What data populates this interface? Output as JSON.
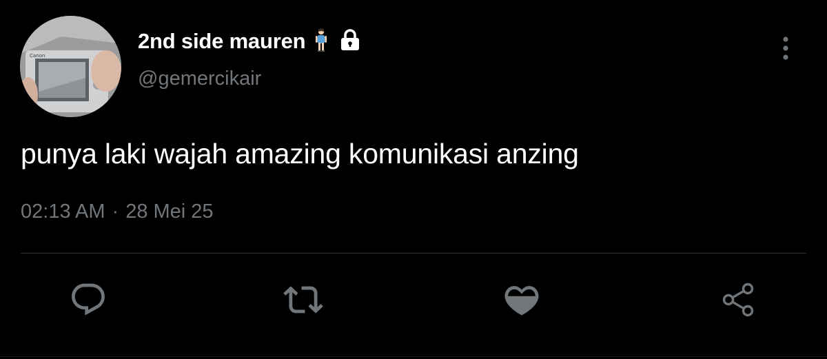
{
  "tweet": {
    "display_name": "2nd side mauren",
    "handle": "@gemercikair",
    "text": "punya laki wajah amazing komunikasi anzing",
    "time": "02:13 AM",
    "separator": "·",
    "date": "28 Mei 25",
    "name_badges": [
      "person-standing-icon",
      "lock-icon"
    ]
  },
  "actions": [
    "reply-icon",
    "retweet-icon",
    "like-icon",
    "share-icon"
  ],
  "colors": {
    "background": "#000000",
    "primary_text": "#ffffff",
    "secondary_text": "#71767b",
    "divider": "#2f3336",
    "icon": "#71767b"
  }
}
